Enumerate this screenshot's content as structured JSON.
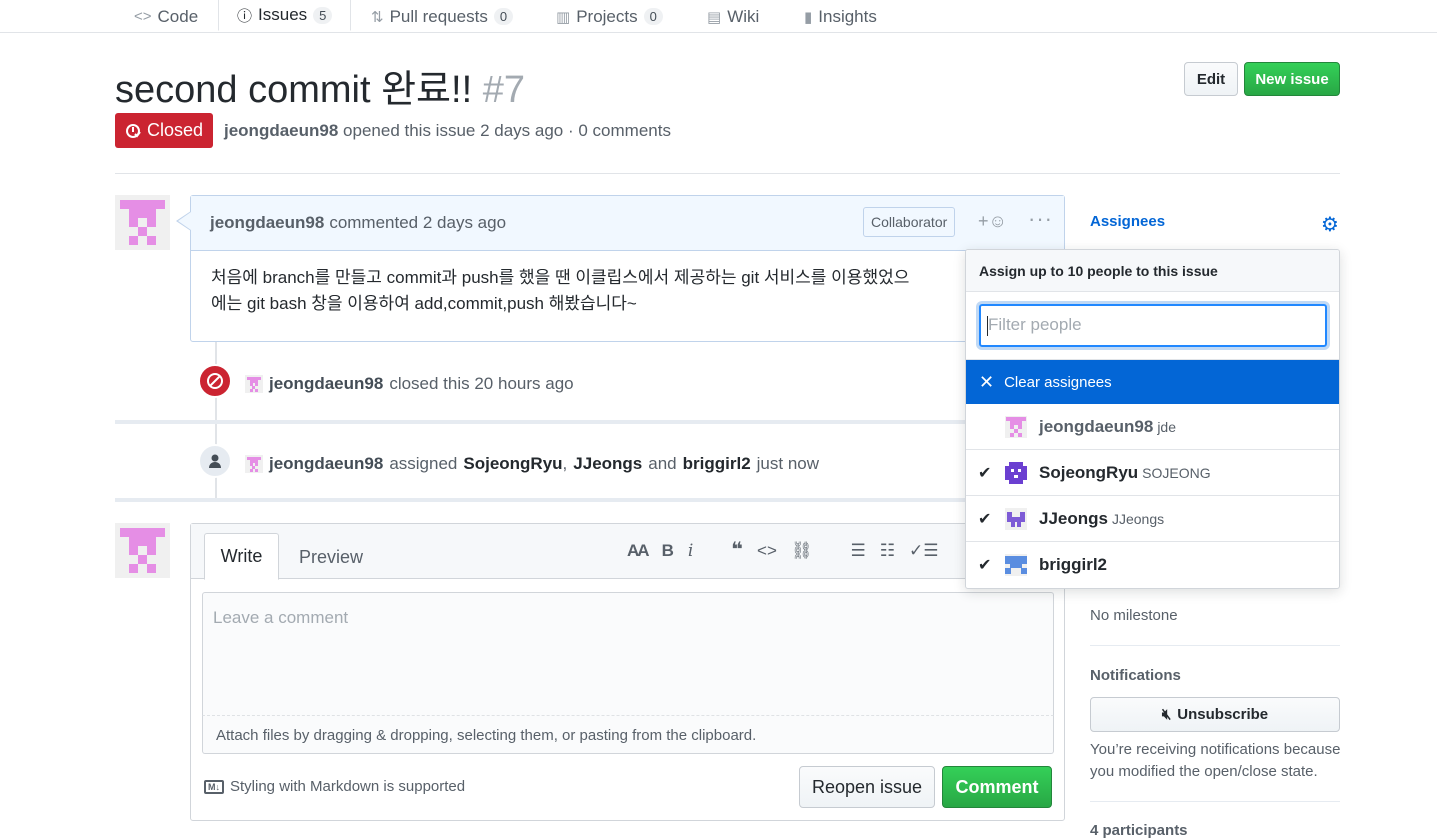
{
  "repo_nav": {
    "tabs": [
      {
        "label": "Code",
        "icon": "code-icon",
        "counter": null
      },
      {
        "label": "Issues",
        "icon": "issue-opened-icon",
        "counter": "5",
        "selected": true
      },
      {
        "label": "Pull requests",
        "icon": "git-pull-request-icon",
        "counter": "0"
      },
      {
        "label": "Projects",
        "icon": "project-icon",
        "counter": "0"
      },
      {
        "label": "Wiki",
        "icon": "book-icon",
        "counter": null
      },
      {
        "label": "Insights",
        "icon": "graph-icon",
        "counter": null
      }
    ]
  },
  "issue": {
    "title": "second commit 완료!!",
    "number": "#7",
    "state": "Closed",
    "author": "jeongdaeun98",
    "meta_rest": "opened this issue 2 days ago · 0 comments",
    "edit_label": "Edit",
    "new_issue_label": "New issue"
  },
  "comment": {
    "author": "jeongdaeun98",
    "action": "commented 2 days ago",
    "role_badge": "Collaborator",
    "body_line1": "처음에 branch를 만들고 commit과 push를 했을 땐 이클립스에서 제공하는 git 서비스를 이용했었으",
    "body_line2": "에는 git bash 창을 이용하여 add,commit,push 해봤습니다~"
  },
  "events": {
    "closed": {
      "actor": "jeongdaeun98",
      "text": "closed this 20 hours ago"
    },
    "assigned": {
      "actor": "jeongdaeun98",
      "verb": "assigned",
      "user1": "SojeongRyu",
      "sep": ",",
      "user2": "JJeongs",
      "and": "and",
      "user3": "briggirl2",
      "time": "just now"
    }
  },
  "comment_form": {
    "tab_write": "Write",
    "tab_preview": "Preview",
    "placeholder": "Leave a comment",
    "attach_hint": "Attach files by dragging & dropping, selecting them, or pasting from the clipboard.",
    "markdown_note": "Styling with Markdown is supported",
    "markdown_icon_text": "M↓",
    "reopen_label": "Reopen issue",
    "comment_label": "Comment",
    "toolbar_icons": [
      "text-size-icon",
      "bold-icon",
      "italic-icon",
      "quote-icon",
      "code-icon",
      "link-icon",
      "list-unordered-icon",
      "list-ordered-icon",
      "tasklist-icon",
      "mention-icon"
    ]
  },
  "sidebar": {
    "assignees_label": "Assignees",
    "milestone_value": "No milestone",
    "notifications_label": "Notifications",
    "unsubscribe_label": "Unsubscribe",
    "notification_reason": "You’re receiving notifications because you modified the open/close state.",
    "participants_label": "4 participants"
  },
  "assignee_popup": {
    "header": "Assign up to 10 people to this issue",
    "filter_placeholder": "Filter people",
    "clear_label": "Clear assignees",
    "people": [
      {
        "name": "jeongdaeun98",
        "login": "jde",
        "checked": false,
        "color": "#e58ee5"
      },
      {
        "name": "SojeongRyu",
        "login": "SOJEONG",
        "checked": true,
        "color": "#6b3fd1"
      },
      {
        "name": "JJeongs",
        "login": "JJeongs",
        "checked": true,
        "color": "#7d5bd6"
      },
      {
        "name": "briggirl2",
        "login": "",
        "checked": true,
        "color": "#5a8de0"
      }
    ]
  },
  "colors": {
    "accent_blue": "#0366d6",
    "closed_red": "#cb2431",
    "green": "#28a745",
    "tab_orange": "#e36209"
  }
}
